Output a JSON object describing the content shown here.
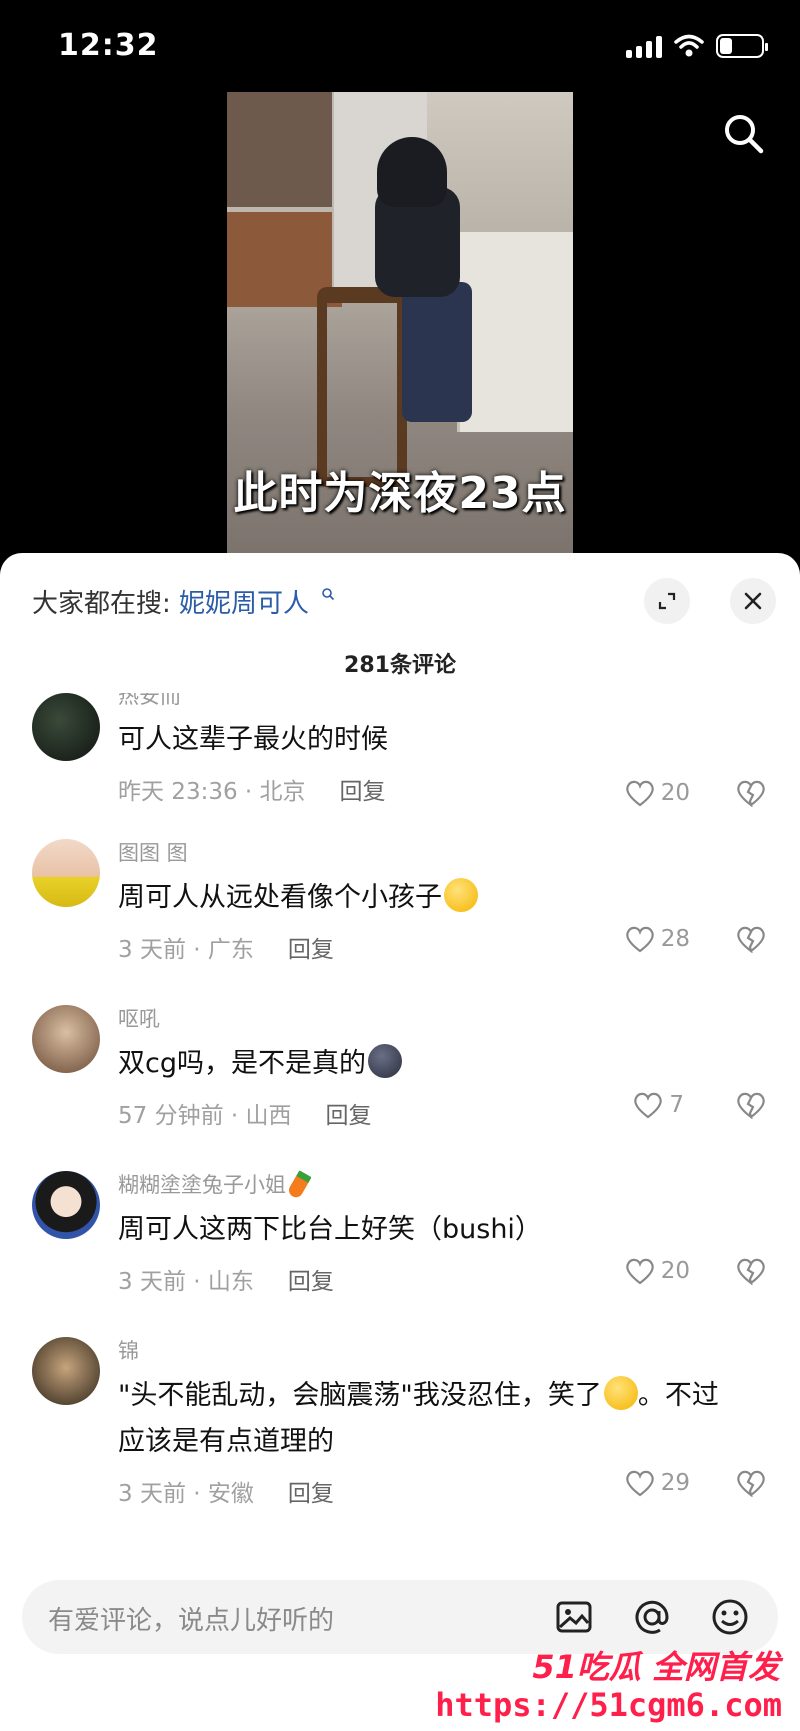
{
  "status_bar": {
    "time": "12:32"
  },
  "video": {
    "subtitle": "此时为深夜23点"
  },
  "sheet": {
    "search_hint_prefix": "大家都在搜:",
    "search_hint_keyword": "妮妮周可人",
    "comment_count": "281条评论"
  },
  "comments": [
    {
      "author": "热安而",
      "text": "可人这辈子最火的时候",
      "time_loc": "昨天 23:36 · 北京",
      "reply": "回复",
      "likes": "20"
    },
    {
      "author": "图图 图",
      "text": "周可人从远处看像个小孩子",
      "time_loc": "3 天前 · 广东",
      "reply": "回复",
      "likes": "28"
    },
    {
      "author": "呕吼",
      "text": "双cg吗，是不是真的",
      "time_loc": "57 分钟前 · 山西",
      "reply": "回复",
      "likes": "7"
    },
    {
      "author": "糊糊塗塗兔子小姐",
      "text": "周可人这两下比台上好笑（bushi）",
      "time_loc": "3 天前 · 山东",
      "reply": "回复",
      "likes": "20"
    },
    {
      "author": "锦",
      "text_line1": "\"头不能乱动，会脑震荡\"我没忍住，笑了",
      "text_line1_tail": "。不过",
      "text_line2": "应该是有点道理的",
      "time_loc": "3 天前 · 安徽",
      "reply": "回复",
      "likes": "29"
    }
  ],
  "input": {
    "placeholder": "有爱评论，说点儿好听的"
  },
  "watermark": {
    "top": "51吃瓜 全网首发",
    "url": "https://51cgm6.com"
  },
  "colors": {
    "link": "#2a5ca8",
    "watermark": "#ff1f4b",
    "sheet_bg": "#ffffff"
  }
}
